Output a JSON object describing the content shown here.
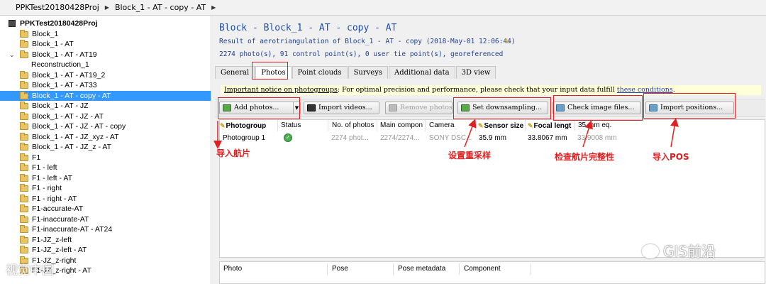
{
  "breadcrumb": {
    "project": "PPKTest20180428Proj",
    "block": "Block_1 - AT - copy - AT"
  },
  "tree": {
    "root": "PPKTest20180428Proj",
    "items": [
      {
        "label": "Block_1",
        "expander": ""
      },
      {
        "label": "Block_1 - AT",
        "expander": ""
      },
      {
        "label": "Block_1 - AT - AT19",
        "expander": "⌄"
      },
      {
        "label": "Reconstruction_1",
        "expander": ""
      },
      {
        "label": "Block_1 - AT - AT19_2",
        "expander": ""
      },
      {
        "label": "Block_1 - AT - AT33",
        "expander": ""
      },
      {
        "label": "Block_1 - AT - copy - AT",
        "expander": ""
      },
      {
        "label": "Block_1 - AT - JZ",
        "expander": ""
      },
      {
        "label": "Block_1 - AT - JZ - AT",
        "expander": ""
      },
      {
        "label": "Block_1 - AT - JZ - AT - copy",
        "expander": ""
      },
      {
        "label": "Block_1 - AT - JZ_xyz - AT",
        "expander": ""
      },
      {
        "label": "Block_1 - AT - JZ_z - AT",
        "expander": ""
      },
      {
        "label": "F1",
        "expander": ""
      },
      {
        "label": "F1 - left",
        "expander": ""
      },
      {
        "label": "F1 - left - AT",
        "expander": ""
      },
      {
        "label": "F1 - right",
        "expander": ""
      },
      {
        "label": "F1 - right - AT",
        "expander": ""
      },
      {
        "label": "F1-accurate-AT",
        "expander": ""
      },
      {
        "label": "F1-inaccurate-AT",
        "expander": ""
      },
      {
        "label": "F1-inaccurate-AT - AT24",
        "expander": ""
      },
      {
        "label": "F1-JZ_z-left",
        "expander": ""
      },
      {
        "label": "F1-JZ_z-left - AT",
        "expander": ""
      },
      {
        "label": "F1-JZ_z-right",
        "expander": ""
      },
      {
        "label": "F1-JZ_z-right - AT",
        "expander": ""
      }
    ]
  },
  "header": {
    "title": "Block - Block_1 - AT - copy - AT",
    "result": "Result of aerotriangulation of Block_1 - AT - copy (2018-May-01 12:06:44)",
    "summary": "2274 photo(s), 91 control point(s), 0 user tie point(s), georeferenced"
  },
  "tabs": [
    "General",
    "Photos",
    "Point clouds",
    "Surveys",
    "Additional data",
    "3D view"
  ],
  "notice": {
    "lead": "Important notice on photogroups",
    "body": ": For optimal precision and performance, please check that your input data fulfill ",
    "link": "these conditions",
    "tail": "."
  },
  "toolbar": {
    "add_photos": "Add photos...",
    "import_videos": "Import videos...",
    "remove_photos": "Remove photos",
    "set_downsampling": "Set downsampling...",
    "check_image_files": "Check image files...",
    "import_positions": "Import positions..."
  },
  "grid": {
    "headers": [
      "Photogroup",
      "Status",
      "No. of photos",
      "Main compon",
      "Camera",
      "Sensor size",
      "Focal lengt",
      "35 mm eq."
    ],
    "row": {
      "photogroup": "Photogroup 1",
      "photos": "2274 phot...",
      "component": "2274/2274...",
      "camera": "SONY DSC...",
      "sensor": "35.9 mm",
      "focal": "33.8067 mm",
      "eq35": "33.9008 mm"
    }
  },
  "bottom_grid": {
    "headers": [
      "Photo",
      "Pose",
      "Pose metadata",
      "Component"
    ]
  },
  "annotations": {
    "import_photos": "导入航片",
    "resample": "设置重采样",
    "check_integrity": "检查航片完整性",
    "import_pos": "导入POS"
  },
  "watermarks": {
    "right": "GIS前沿",
    "left": "视觉中国"
  },
  "colors": {
    "selection": "#3399ff",
    "title_blue": "#1f4fa6",
    "annotation_red": "#e02020",
    "notice_bg": "#ffffd8"
  }
}
